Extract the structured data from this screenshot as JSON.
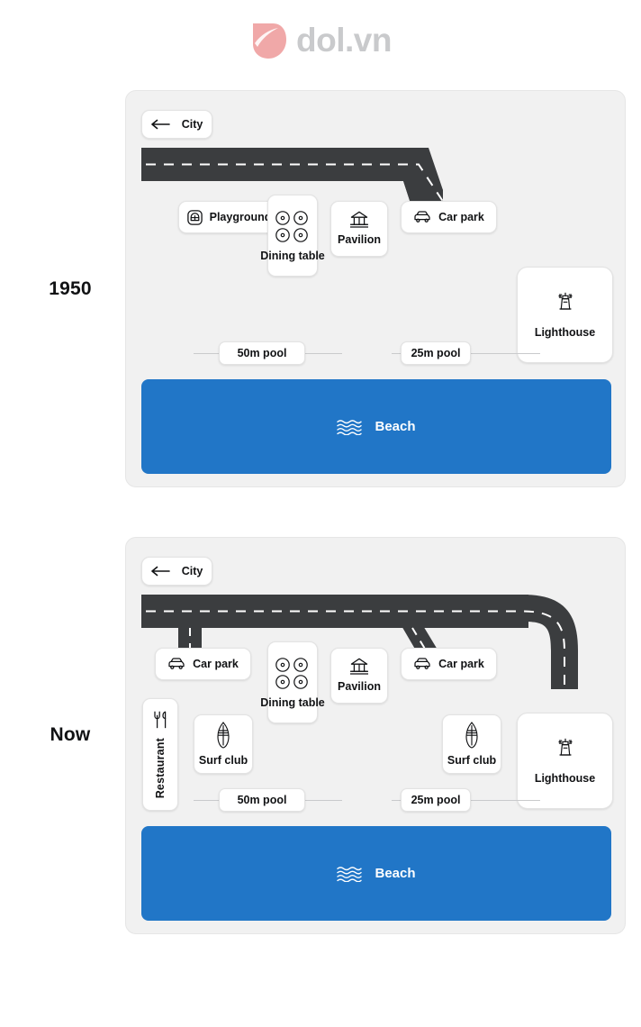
{
  "brand": {
    "logo_icon": "dol-leaf-logo",
    "name": "dol.vn",
    "logo_color": "#f0a8a8",
    "text_color": "#c9cacc"
  },
  "colors": {
    "panel_bg": "#f1f1f1",
    "card_bg": "#ffffff",
    "road": "#3b3d3f",
    "beach": "#2176c7",
    "text": "#111214"
  },
  "diagrams": [
    {
      "year_label": "1950",
      "city_chip": {
        "label": "City",
        "icon": "arrow-left-icon"
      },
      "road": {
        "type": "horizontal-with-diagonal-branch",
        "dashes": true
      },
      "features": [
        {
          "key": "playground",
          "label": "Playground",
          "icon": "playground-icon"
        },
        {
          "key": "dining_table",
          "label": "Dining table",
          "icon": "dining-table-icon"
        },
        {
          "key": "pavilion",
          "label": "Pavilion",
          "icon": "pavilion-icon"
        },
        {
          "key": "car_park_right",
          "label": "Car park",
          "icon": "car-icon"
        },
        {
          "key": "lighthouse",
          "label": "Lighthouse",
          "icon": "lighthouse-icon"
        }
      ],
      "pools": [
        {
          "label": "50m pool"
        },
        {
          "label": "25m pool"
        }
      ],
      "beach": {
        "label": "Beach",
        "icon": "waves-icon"
      }
    },
    {
      "year_label": "Now",
      "city_chip": {
        "label": "City",
        "icon": "arrow-left-icon"
      },
      "road": {
        "type": "horizontal-with-vertical-diagonal-and-curve",
        "dashes": true
      },
      "features": [
        {
          "key": "car_park_left",
          "label": "Car park",
          "icon": "car-icon"
        },
        {
          "key": "dining_table",
          "label": "Dining table",
          "icon": "dining-table-icon"
        },
        {
          "key": "pavilion",
          "label": "Pavilion",
          "icon": "pavilion-icon"
        },
        {
          "key": "car_park_right",
          "label": "Car park",
          "icon": "car-icon"
        },
        {
          "key": "restaurant",
          "label": "Restaurant",
          "icon": "cutlery-icon"
        },
        {
          "key": "surf_club_left",
          "label": "Surf club",
          "icon": "surfboard-icon"
        },
        {
          "key": "surf_club_right",
          "label": "Surf club",
          "icon": "surfboard-icon"
        },
        {
          "key": "lighthouse",
          "label": "Lighthouse",
          "icon": "lighthouse-icon"
        }
      ],
      "pools": [
        {
          "label": "50m pool"
        },
        {
          "label": "25m pool"
        }
      ],
      "beach": {
        "label": "Beach",
        "icon": "waves-icon"
      }
    }
  ]
}
